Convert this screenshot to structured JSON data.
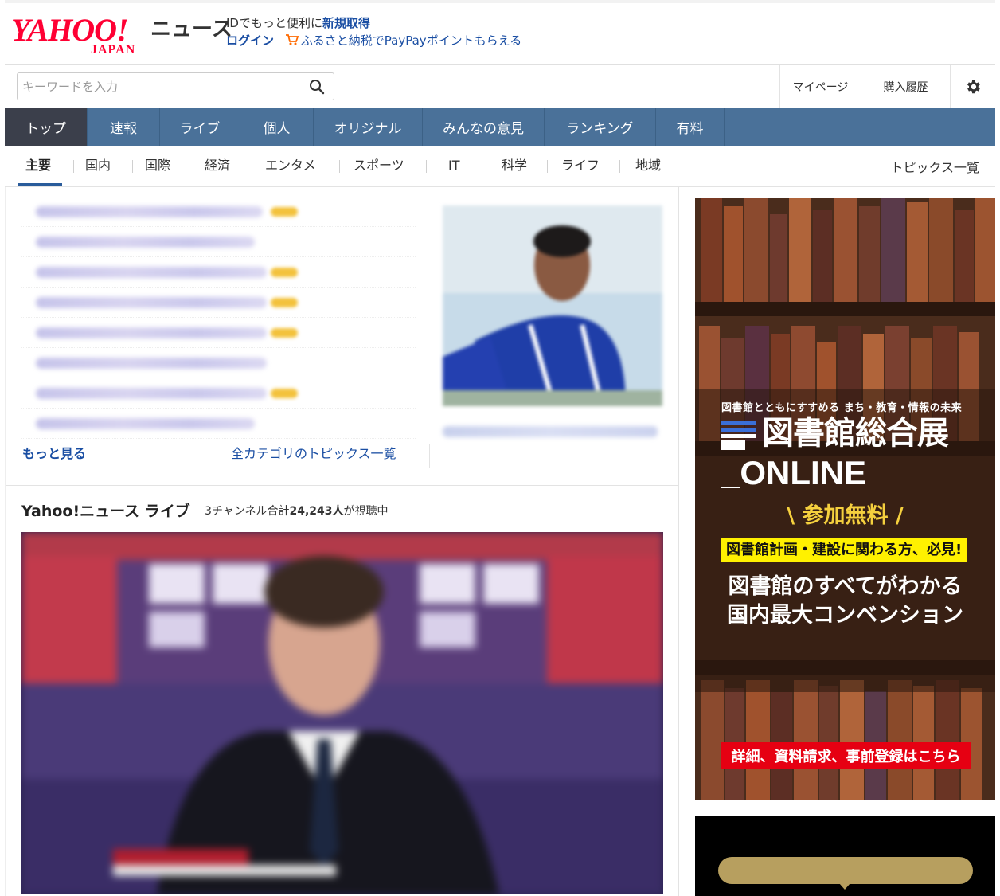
{
  "header": {
    "logo_yahoo": "YAHOO!",
    "logo_japan": "JAPAN",
    "logo_news": "ニュース",
    "promo_line1_text": "IDでもっと便利に",
    "promo_line1_link": "新規取得",
    "login_label": "ログイン",
    "promo_line2_link": "ふるさと納税でPayPayポイントもらえる"
  },
  "search": {
    "placeholder": "キーワードを入力",
    "icon": "search-icon"
  },
  "utility": {
    "mypage": "マイページ",
    "history": "購入履歴",
    "settings_icon": "gear-icon"
  },
  "categories": {
    "items": [
      {
        "label": "トップ"
      },
      {
        "label": "速報"
      },
      {
        "label": "ライブ"
      },
      {
        "label": "個人"
      },
      {
        "label": "オリジナル"
      },
      {
        "label": "みんなの意見"
      },
      {
        "label": "ランキング"
      },
      {
        "label": "有料"
      }
    ]
  },
  "subnav": {
    "items": [
      {
        "label": "主要"
      },
      {
        "label": "国内"
      },
      {
        "label": "国際"
      },
      {
        "label": "経済"
      },
      {
        "label": "エンタメ"
      },
      {
        "label": "スポーツ"
      },
      {
        "label": "IT"
      },
      {
        "label": "科学"
      },
      {
        "label": "ライフ"
      },
      {
        "label": "地域"
      }
    ],
    "topics_all": "トピックス一覧"
  },
  "topics": {
    "more": "もっと見る",
    "all_categories": "全カテゴリのトピックス一覧"
  },
  "live": {
    "title": "Yahoo!ニュース ライブ",
    "meta_prefix": "3チャンネル合計",
    "viewer_count": "24,243人",
    "meta_suffix": "が視聴中"
  },
  "ad": {
    "subtitle": "図書館とともにすすめる まち・教育・情報の未来",
    "title": "図書館総合展",
    "online": "_ONLINE",
    "free": "\\ 参加無料 /",
    "highlight": "図書館計画・建設に関わる方、必見!",
    "desc_line1": "図書館のすべてがわかる",
    "desc_line2": "国内最大コンベンション",
    "cta": "詳細、資料請求、事前登録はこちら"
  },
  "colors": {
    "brand_red": "#ff0033",
    "link_blue": "#1a4ea3",
    "nav_blue": "#4a7199",
    "nav_active": "#3b3f4b",
    "ad_red": "#e60012",
    "ad_yellow": "#fff100"
  }
}
